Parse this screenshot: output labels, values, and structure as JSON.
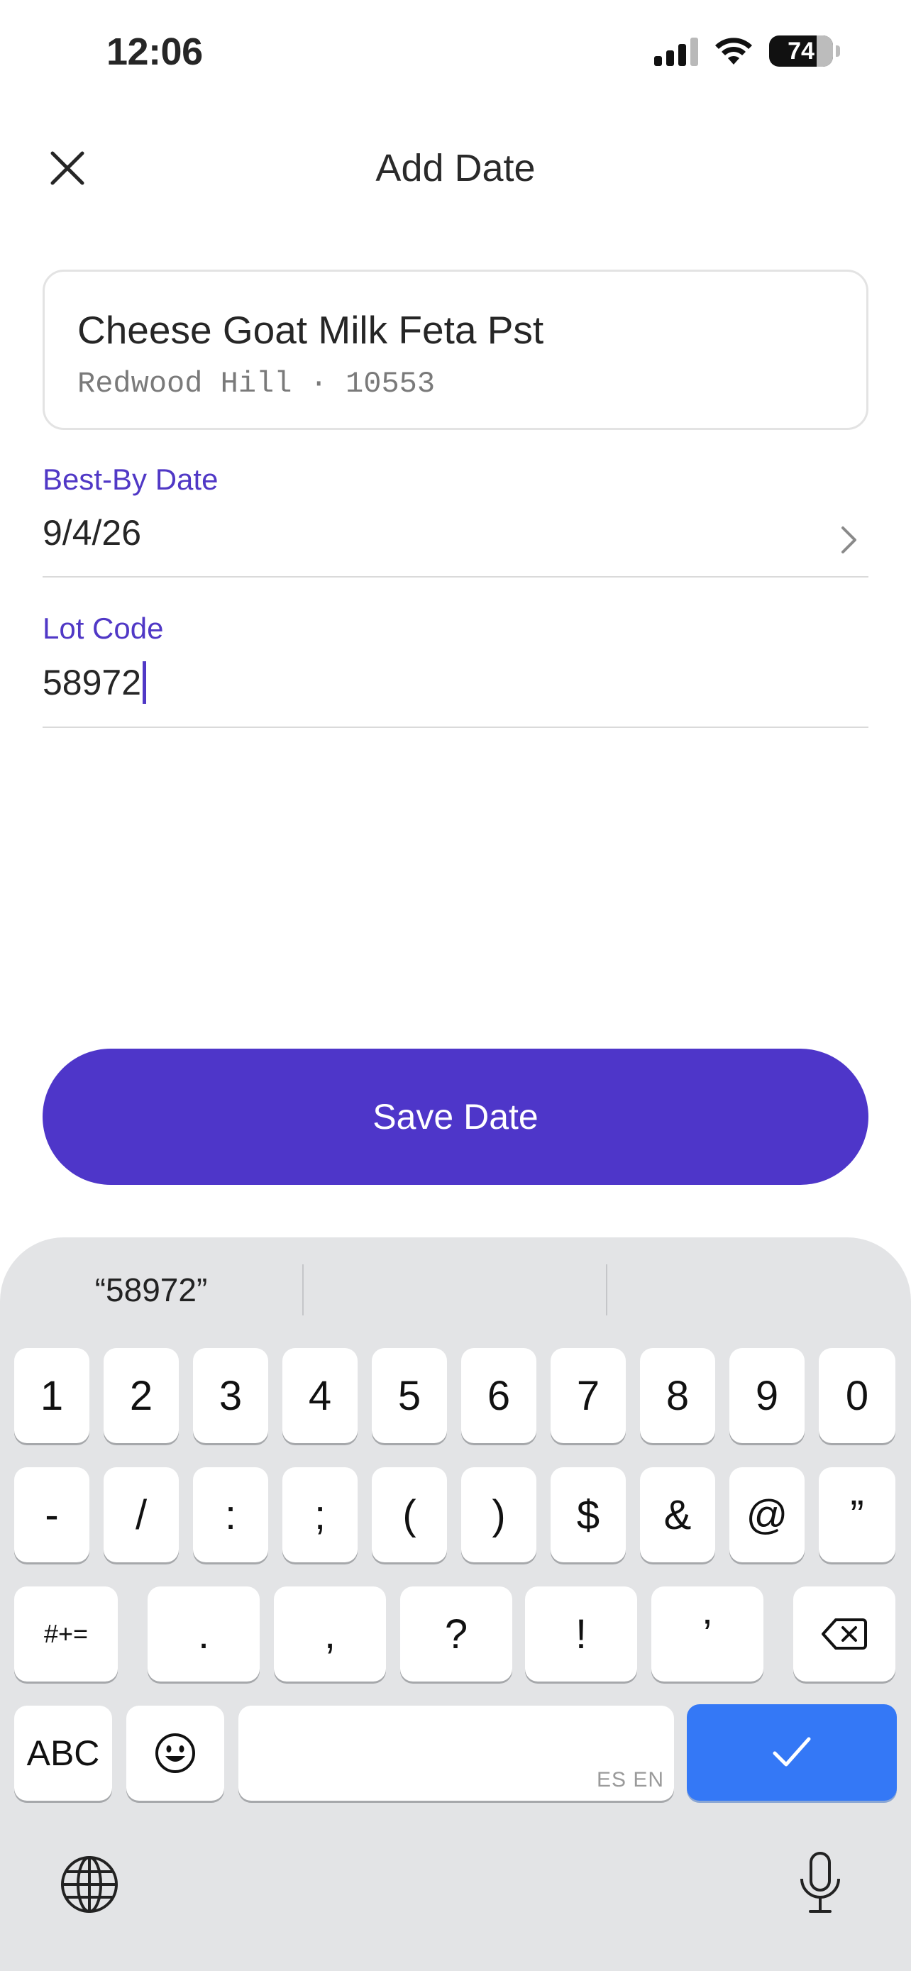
{
  "status_bar": {
    "time": "12:06",
    "battery_percent": "74",
    "battery_level": 0.74
  },
  "header": {
    "title": "Add Date",
    "close_icon": "close-icon"
  },
  "product": {
    "name": "Cheese Goat Milk Feta Pst",
    "subtitle": "Redwood Hill · 10553"
  },
  "fields": {
    "best_by": {
      "label": "Best-By Date",
      "value": "9/4/26"
    },
    "lot_code": {
      "label": "Lot Code",
      "value": "58972"
    }
  },
  "save_button": {
    "label": "Save Date"
  },
  "keyboard": {
    "suggestions": [
      "“58972”",
      "",
      ""
    ],
    "row1": [
      "1",
      "2",
      "3",
      "4",
      "5",
      "6",
      "7",
      "8",
      "9",
      "0"
    ],
    "row2": [
      "-",
      "/",
      ":",
      ";",
      "(",
      ")",
      "$",
      "&",
      "@",
      "”"
    ],
    "row3": {
      "shift": "#+=",
      "keys": [
        ".",
        ",",
        "?",
        "!",
        "’"
      ]
    },
    "row4": {
      "abc": "ABC",
      "space_lang": "ES EN"
    },
    "icons": [
      "backspace-icon",
      "emoji-icon",
      "checkmark-icon",
      "globe-icon",
      "microphone-icon"
    ]
  },
  "colors": {
    "accent": "#4e36c9",
    "label": "#5038c6",
    "keyboard_return": "#3478f6",
    "keyboard_bg": "#e3e4e6"
  }
}
